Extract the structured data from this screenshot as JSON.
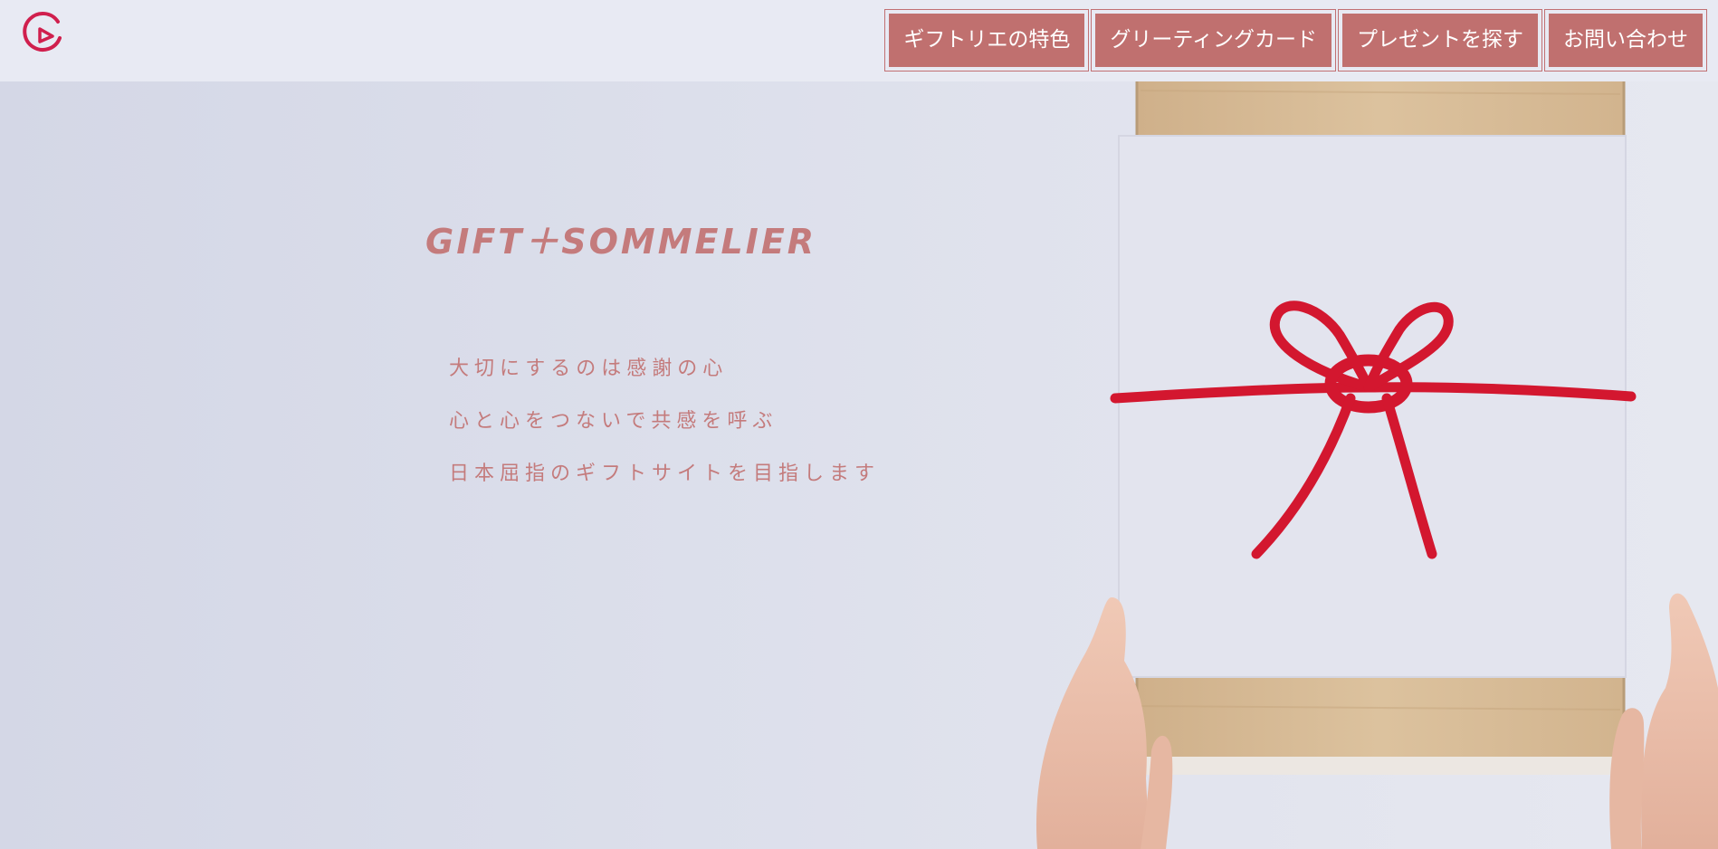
{
  "brand": {
    "logo_icon": "gift-logo-icon",
    "accent_color": "#d01f4d"
  },
  "nav": {
    "items": [
      {
        "label": "ギフトリエの特色"
      },
      {
        "label": "グリーティングカード"
      },
      {
        "label": "プレゼントを探す"
      },
      {
        "label": "お問い合わせ"
      }
    ],
    "button_color": "#c0706f"
  },
  "hero": {
    "title": "GIFT＋SOMMELIER",
    "tagline_lines": [
      "大切にするのは感謝の心",
      "心と心をつないで共感を呼ぶ",
      "日本屈指のギフトサイトを目指します"
    ],
    "text_color": "#c47b7c",
    "image_icon": "gift-box-with-red-cord-photo"
  }
}
